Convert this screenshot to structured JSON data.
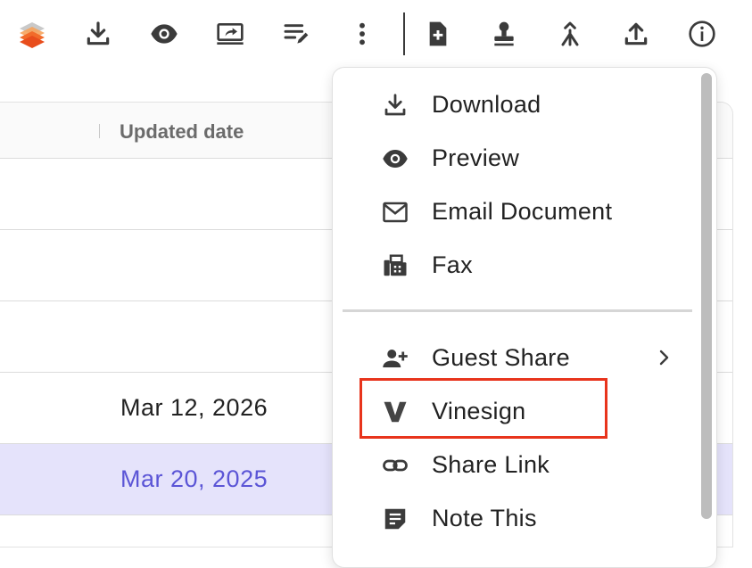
{
  "toolbar": {
    "icons": [
      "layers-icon",
      "download-icon",
      "preview-icon",
      "present-icon",
      "edit-list-icon",
      "more-vert-icon",
      "new-document-icon",
      "stamp-icon",
      "merge-icon",
      "upload-icon",
      "info-icon"
    ],
    "accent": "#f05a28"
  },
  "table": {
    "header": {
      "updated_date": "Updated date"
    },
    "rows": [
      {
        "date": ""
      },
      {
        "date": ""
      },
      {
        "date": ""
      },
      {
        "date": "Mar 12, 2026"
      },
      {
        "date": "Mar 20, 2025",
        "selected": true
      }
    ],
    "selected_color": "#e5e3fb",
    "selected_text_color": "#5b55d6"
  },
  "menu": {
    "items": [
      {
        "label": "Download",
        "icon": "download-icon"
      },
      {
        "label": "Preview",
        "icon": "eye-icon"
      },
      {
        "label": "Email Document",
        "icon": "mail-icon"
      },
      {
        "label": "Fax",
        "icon": "fax-icon"
      },
      {
        "label": "Guest Share",
        "icon": "person-add-icon",
        "submenu": true
      },
      {
        "label": "Vinesign",
        "icon": "vinesign-icon",
        "highlighted": true
      },
      {
        "label": "Share Link",
        "icon": "link-icon"
      },
      {
        "label": "Note This",
        "icon": "note-icon"
      }
    ],
    "highlight_color": "#e8341c"
  }
}
